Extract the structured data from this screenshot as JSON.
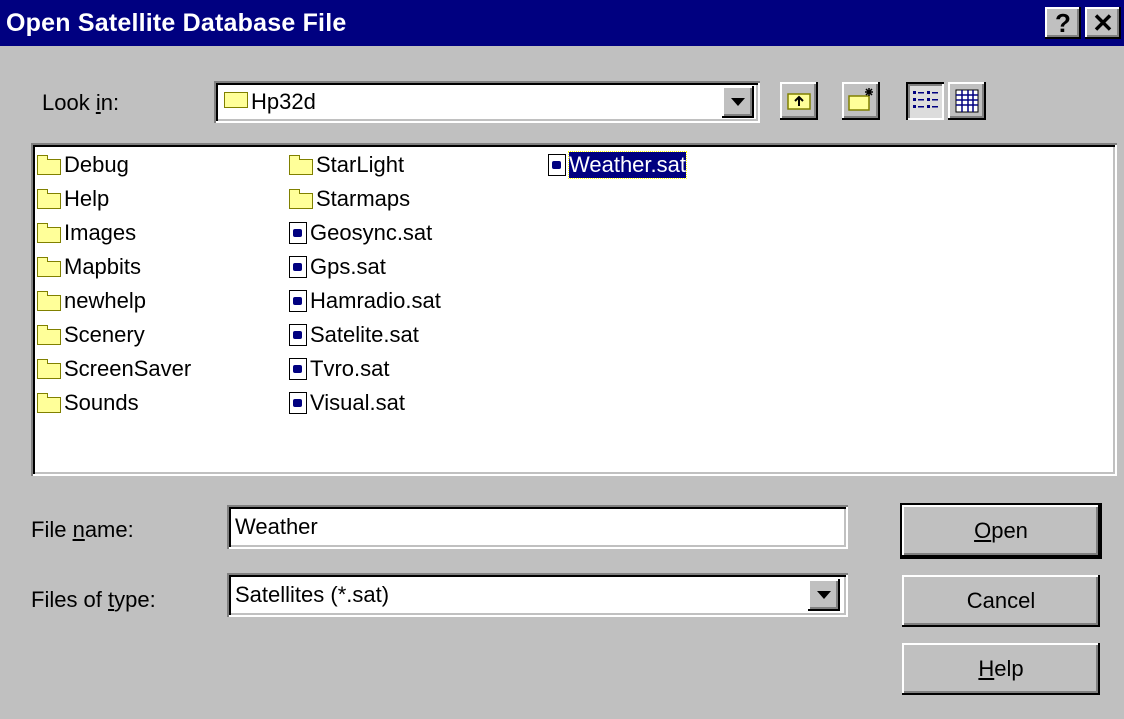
{
  "window": {
    "title": "Open Satellite Database File"
  },
  "titlebar": {
    "help_label": "?",
    "close_label": "✕"
  },
  "look_in": {
    "label_pre": "Look ",
    "label_ul": "i",
    "label_post": "n:",
    "value": "Hp32d"
  },
  "toolbar": {
    "up_icon": "up-one-level-icon",
    "new_folder_icon": "create-new-folder-icon",
    "list_icon": "list-view-icon",
    "details_icon": "details-view-icon"
  },
  "files": {
    "column1": [
      "Debug",
      "Help",
      "Images",
      "Mapbits",
      "newhelp",
      "Scenery",
      "ScreenSaver",
      "Sounds"
    ],
    "column2_folders": [
      "StarLight",
      "Starmaps"
    ],
    "column2_files": [
      "Geosync.sat",
      "Gps.sat",
      "Hamradio.sat",
      "Satelite.sat",
      "Tvro.sat",
      "Visual.sat"
    ],
    "column3_files": [
      "Weather.sat"
    ],
    "selected": "Weather.sat"
  },
  "file_name": {
    "label_pre": "File ",
    "label_ul": "n",
    "label_post": "ame:",
    "value": "Weather"
  },
  "file_type": {
    "label_pre": "Files of ",
    "label_ul": "t",
    "label_post": "ype:",
    "value": "Satellites (*.sat)"
  },
  "buttons": {
    "open": "Open",
    "cancel": "Cancel",
    "help": "Help"
  },
  "colors": {
    "titlebar": "#000080",
    "face": "#c0c0c0",
    "selection": "#000080"
  }
}
